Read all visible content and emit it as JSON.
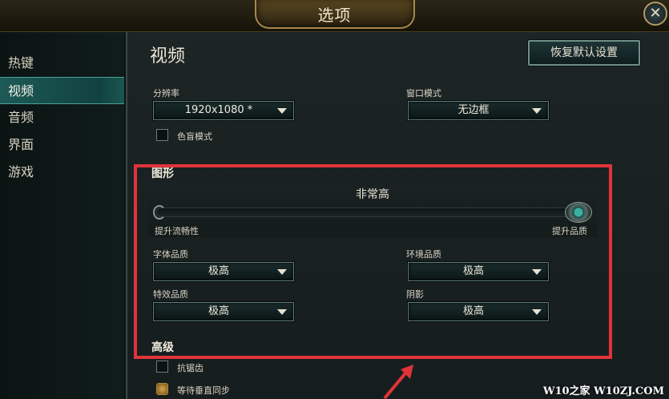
{
  "window": {
    "title": "选项",
    "close_glyph": "✕"
  },
  "sidebar": {
    "items": [
      {
        "label": "热键",
        "active": false
      },
      {
        "label": "视频",
        "active": true
      },
      {
        "label": "音频",
        "active": false
      },
      {
        "label": "界面",
        "active": false
      },
      {
        "label": "游戏",
        "active": false
      }
    ]
  },
  "main": {
    "title": "视频",
    "reset_label": "恢复默认设置",
    "resolution": {
      "label": "分辨率",
      "value": "1920x1080 *"
    },
    "window_mode": {
      "label": "窗口模式",
      "value": "无边框"
    },
    "colorblind": {
      "label": "色盲模式",
      "checked": false
    },
    "graphics": {
      "title": "图形",
      "quality_value": "非常高",
      "slider_level": 1.0,
      "min_label": "提升流畅性",
      "max_label": "提升品质",
      "character_quality": {
        "label": "字体品质",
        "value": "极高"
      },
      "environment_quality": {
        "label": "环境品质",
        "value": "极高"
      },
      "effects_quality": {
        "label": "特效品质",
        "value": "极高"
      },
      "shadows": {
        "label": "阴影",
        "value": "极高"
      }
    },
    "advanced": {
      "title": "高级",
      "antialiasing": {
        "label": "抗锯齿",
        "checked": false
      },
      "vsync": {
        "label": "等待垂直同步",
        "checked": true
      }
    }
  },
  "annotation": {
    "color": "#e0343a"
  },
  "watermark": "W10之家 W10ZJ.COM"
}
